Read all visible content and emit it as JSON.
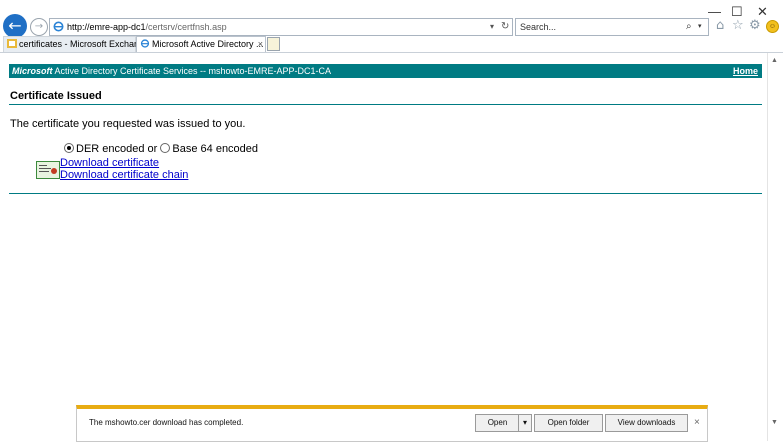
{
  "window": {
    "minimize_glyph": "—",
    "maximize_glyph": "☐",
    "close_glyph": "✕"
  },
  "nav": {
    "back_glyph": "←",
    "forward_glyph": "→"
  },
  "address_bar": {
    "url_domain": "http://emre-app-dc1",
    "url_path": "/certsrv/certfnsh.asp",
    "dropdown_glyph": "▾",
    "refresh_glyph": "↻"
  },
  "search": {
    "placeholder": "Search...",
    "search_glyph": "⌕",
    "dropdown_glyph": "▾"
  },
  "toolbar": {
    "home_glyph": "⌂",
    "favorites_glyph": "☆",
    "tools_glyph": "⚙",
    "feedback_glyph": "☺"
  },
  "tabs": [
    {
      "label": "certificates - Microsoft Exchange",
      "active": false
    },
    {
      "label": "Microsoft Active Directory ...",
      "active": true,
      "close": "×"
    }
  ],
  "page": {
    "banner_brand": "Microsoft",
    "banner_title": " Active Directory Certificate Services  --  mshowto-EMRE-APP-DC1-CA",
    "home_link": "Home",
    "title": "Certificate Issued",
    "message": "The certificate you requested was issued to you.",
    "encoding": {
      "option1": "DER encoded",
      "separator": " or ",
      "option2": "Base 64 encoded",
      "selected": "DER encoded"
    },
    "links": {
      "download_certificate": "Download certificate",
      "download_chain": "Download certificate chain"
    }
  },
  "download_bar": {
    "message": "The mshowto.cer download has completed.",
    "open_label": "Open",
    "open_menu_glyph": "▾",
    "open_folder_label": "Open folder",
    "view_downloads_label": "View downloads",
    "close_glyph": "×"
  },
  "scrollbar": {
    "up_glyph": "▲",
    "down_glyph": "▼"
  },
  "colors": {
    "banner": "#007b83",
    "link": "#0000cc",
    "notification_accent": "#e8ac12",
    "back_button": "#1f6fc5"
  }
}
